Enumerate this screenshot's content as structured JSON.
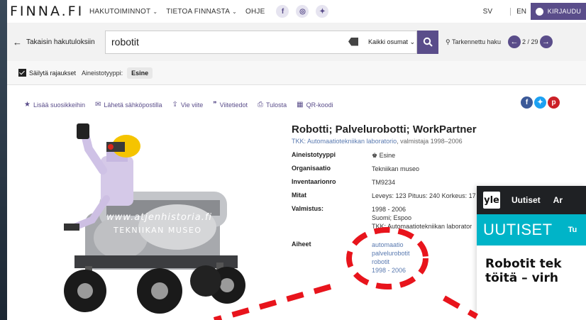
{
  "nav": {
    "logo": "FINNA.FI",
    "items": [
      "HAKUTOIMINNOT",
      "TIETOA FINNASTA",
      "OHJE"
    ],
    "social": [
      "f",
      "ig",
      "tw"
    ],
    "lang_sv": "SV",
    "lang_en": "EN",
    "login": "KIRJAUDU"
  },
  "search": {
    "back": "Takaisin hakutuloksiin",
    "query": "robotit",
    "scope": "Kaikki osumat",
    "advanced": "Tarkennettu haku",
    "pager": "2 / 29"
  },
  "filters": {
    "keep": "Säilytä rajaukset",
    "label": "Aineistotyyppi:",
    "chip": "Esine"
  },
  "actions": [
    {
      "icon": "star-icon",
      "glyph": "★",
      "label": "Lisää suosikkeihin"
    },
    {
      "icon": "mail-icon",
      "glyph": "✉",
      "label": "Lähetä sähköpostilla"
    },
    {
      "icon": "export-icon",
      "glyph": "⇪",
      "label": "Vie viite"
    },
    {
      "icon": "quote-icon",
      "glyph": "❞",
      "label": "Viitetiedot"
    },
    {
      "icon": "print-icon",
      "glyph": "⎙",
      "label": "Tulosta"
    },
    {
      "icon": "qr-icon",
      "glyph": "▦",
      "label": "QR-koodi"
    }
  ],
  "share_colors": {
    "facebook": "#3b5998",
    "twitter": "#1da1f2",
    "pinterest": "#cb2027"
  },
  "record": {
    "title": "Robotti; Palvelurobotti; WorkPartner",
    "org_link": "TKK: Automaatiotekniikan laboratorio",
    "sub_rest": ", valmistaja 1998–2006",
    "fields": {
      "type_k": "Aineistotyyppi",
      "type_v": "Esine",
      "org_k": "Organisaatio",
      "org_v": "Tekniikan museo",
      "inv_k": "Inventaarionro",
      "inv_v": "TM9234",
      "dim_k": "Mitat",
      "dim_v": "Leveys: 123 Pituus: 240 Korkeus: 17",
      "made_k": "Valmistus:",
      "made_1": "1998 - 2006",
      "made_2": "Suomi; Espoo",
      "made_3": "TKK: Automaatiotekniikan laborator",
      "subj_k": "Aiheet",
      "subj": [
        "automaatio",
        "palvelurobotit",
        "robotit",
        "1998 - 2006"
      ]
    }
  },
  "image_watermark": [
    "www.atjenhistoria.fi",
    "TEKNIIKAN MUSEO"
  ],
  "yle": {
    "logo": "yle",
    "nav1": "Uutiset",
    "nav2": "Ar",
    "band": "UUTISET",
    "band2": "Tu",
    "headline1": "Robotit tek",
    "headline2": "töitä – virh"
  },
  "colors": {
    "accent": "#5a4d8a",
    "link": "#5a7ab0",
    "yle_teal": "#00b4c8",
    "annotation": "#e8141c"
  }
}
